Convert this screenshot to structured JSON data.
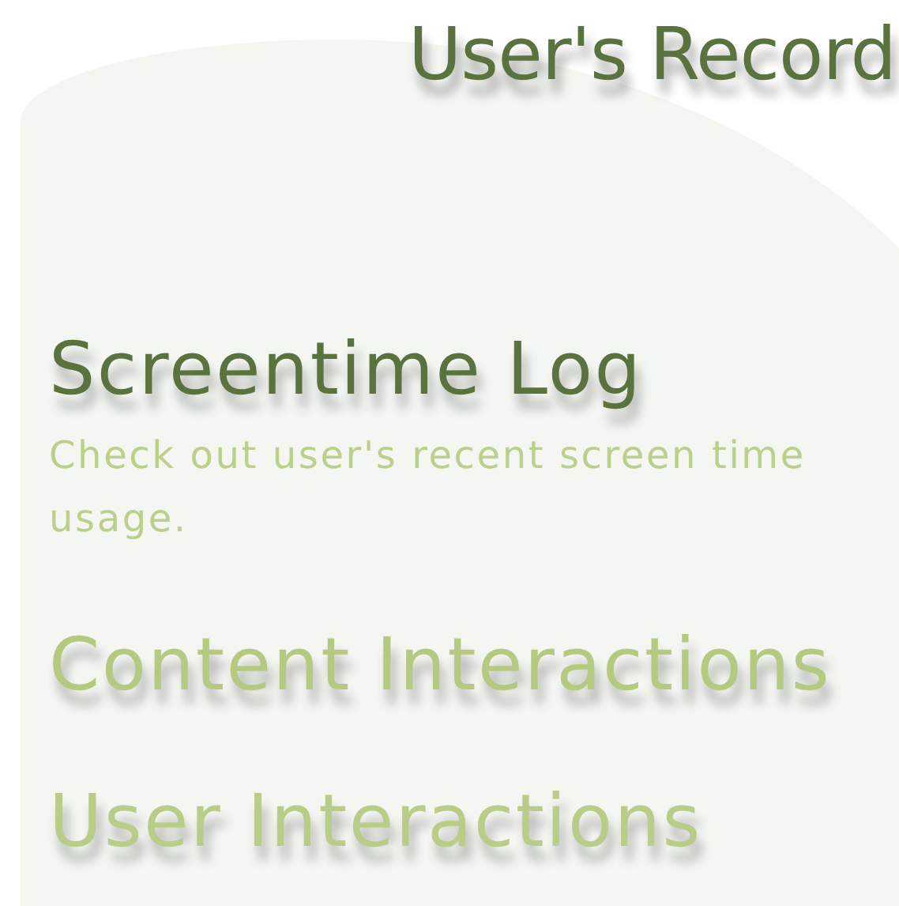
{
  "title": "User's Record",
  "sections": [
    {
      "label": "Screentime Log",
      "selected": true,
      "description": "Check out user's recent screen time usage."
    },
    {
      "label": "Content Interactions",
      "selected": false
    },
    {
      "label": "User Interactions",
      "selected": false
    }
  ]
}
